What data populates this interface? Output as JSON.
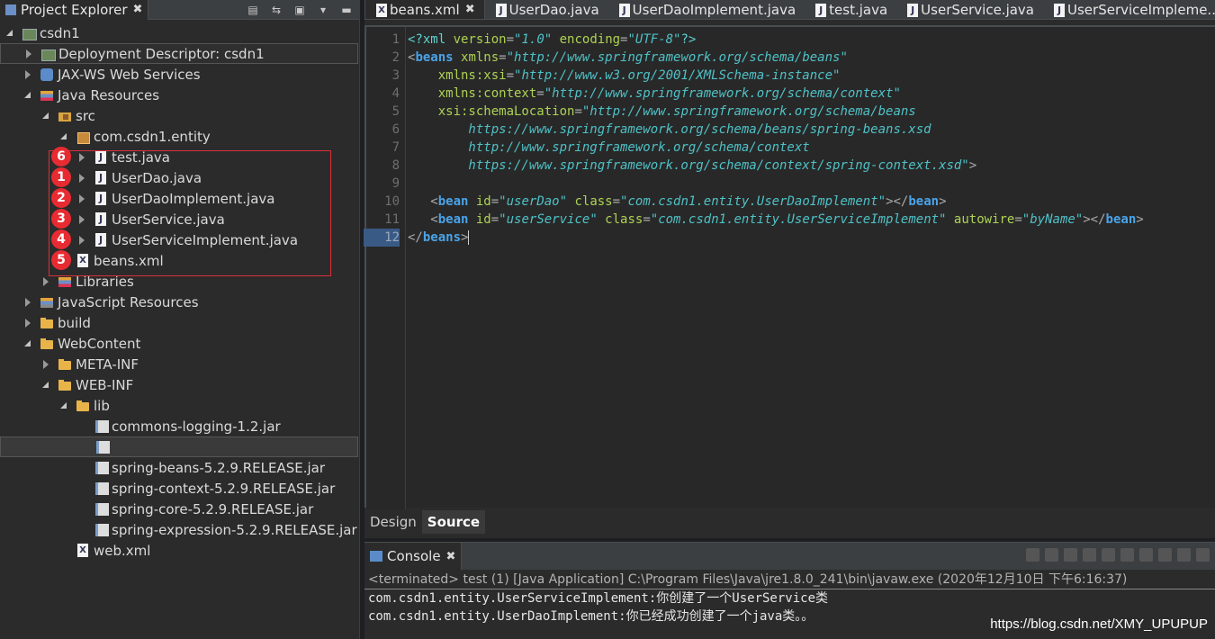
{
  "project_explorer": {
    "tab_label": "Project Explorer",
    "tree": [
      {
        "label": "csdn1",
        "icon": "project-icon",
        "state": "open",
        "level": 0
      },
      {
        "label": "Deployment Descriptor: csdn1",
        "icon": "deployment-descriptor-icon",
        "state": "closed",
        "level": 1,
        "selected": true
      },
      {
        "label": "JAX-WS Web Services",
        "icon": "web-services-icon",
        "state": "closed",
        "level": 1
      },
      {
        "label": "Java Resources",
        "icon": "java-resources-icon",
        "state": "open",
        "level": 1
      },
      {
        "label": "src",
        "icon": "source-folder-icon",
        "state": "open",
        "level": 2
      },
      {
        "label": "com.csdn1.entity",
        "icon": "package-icon",
        "state": "open",
        "level": 3
      },
      {
        "label": "test.java",
        "icon": "java-file-icon",
        "state": "closed",
        "level": 4,
        "badge": "6"
      },
      {
        "label": "UserDao.java",
        "icon": "java-interface-icon",
        "state": "closed",
        "level": 4,
        "badge": "1"
      },
      {
        "label": "UserDaoImplement.java",
        "icon": "java-file-icon",
        "state": "closed",
        "level": 4,
        "badge": "2"
      },
      {
        "label": "UserService.java",
        "icon": "java-interface-icon",
        "state": "closed",
        "level": 4,
        "badge": "3"
      },
      {
        "label": "UserServiceImplement.java",
        "icon": "java-file-icon",
        "state": "closed",
        "level": 4,
        "badge": "4"
      },
      {
        "label": "beans.xml",
        "icon": "xml-file-icon",
        "state": "none",
        "level": 3,
        "badge": "5"
      },
      {
        "label": "Libraries",
        "icon": "libraries-icon",
        "state": "closed",
        "level": 2
      },
      {
        "label": "JavaScript Resources",
        "icon": "javascript-resources-icon",
        "state": "closed",
        "level": 1
      },
      {
        "label": "build",
        "icon": "folder-icon",
        "state": "closed",
        "level": 1
      },
      {
        "label": "WebContent",
        "icon": "folder-icon",
        "state": "open",
        "level": 1
      },
      {
        "label": "META-INF",
        "icon": "folder-icon",
        "state": "closed",
        "level": 2
      },
      {
        "label": "WEB-INF",
        "icon": "folder-icon",
        "state": "open",
        "level": 2
      },
      {
        "label": "lib",
        "icon": "folder-icon",
        "state": "open",
        "level": 3
      },
      {
        "label": "commons-logging-1.2.jar",
        "icon": "jar-icon",
        "state": "none",
        "level": 4
      },
      {
        "label": "",
        "icon": "jar-icon",
        "state": "none",
        "level": 4,
        "highlighted": true
      },
      {
        "label": "spring-beans-5.2.9.RELEASE.jar",
        "icon": "jar-icon",
        "state": "none",
        "level": 4
      },
      {
        "label": "spring-context-5.2.9.RELEASE.jar",
        "icon": "jar-icon",
        "state": "none",
        "level": 4
      },
      {
        "label": "spring-core-5.2.9.RELEASE.jar",
        "icon": "jar-icon",
        "state": "none",
        "level": 4
      },
      {
        "label": "spring-expression-5.2.9.RELEASE.jar",
        "icon": "jar-icon",
        "state": "none",
        "level": 4
      },
      {
        "label": "web.xml",
        "icon": "xml-file-icon",
        "state": "none",
        "level": 3
      }
    ]
  },
  "editor": {
    "tabs": [
      {
        "label": "beans.xml",
        "icon": "xml-file-icon",
        "active": true
      },
      {
        "label": "UserDao.java",
        "icon": "java-file-icon"
      },
      {
        "label": "UserDaoImplement.java",
        "icon": "java-file-icon"
      },
      {
        "label": "test.java",
        "icon": "java-file-icon"
      },
      {
        "label": "UserService.java",
        "icon": "java-file-icon"
      },
      {
        "label": "UserServiceImpleme...",
        "icon": "java-file-icon"
      }
    ],
    "line_numbers": [
      "1",
      "2",
      "3",
      "4",
      "5",
      "6",
      "7",
      "8",
      "9",
      "10",
      "11",
      "12"
    ],
    "current_line": "12",
    "code_lines": [
      [
        [
          "pi",
          "<?xml "
        ],
        [
          "attr",
          "version"
        ],
        [
          "punc",
          "="
        ],
        [
          "val",
          "\"1.0\""
        ],
        [
          "attr",
          " encoding"
        ],
        [
          "punc",
          "="
        ],
        [
          "val",
          "\"UTF-8\""
        ],
        [
          "pi",
          "?>"
        ]
      ],
      [
        [
          "punc",
          "<"
        ],
        [
          "tag",
          "beans"
        ],
        [
          "attr",
          " xmlns"
        ],
        [
          "punc",
          "="
        ],
        [
          "val",
          "\"http://www.springframework.org/schema/beans\""
        ]
      ],
      [
        [
          "attr",
          "    xmlns:xsi"
        ],
        [
          "punc",
          "="
        ],
        [
          "val",
          "\"http://www.w3.org/2001/XMLSchema-instance\""
        ]
      ],
      [
        [
          "attr",
          "    xmlns:context"
        ],
        [
          "punc",
          "="
        ],
        [
          "val",
          "\"http://www.springframework.org/schema/context\""
        ]
      ],
      [
        [
          "attr",
          "    xsi:schemaLocation"
        ],
        [
          "punc",
          "="
        ],
        [
          "val",
          "\"http://www.springframework.org/schema/beans"
        ]
      ],
      [
        [
          "val",
          "        https://www.springframework.org/schema/beans/spring-beans.xsd"
        ]
      ],
      [
        [
          "val",
          "        http://www.springframework.org/schema/context"
        ]
      ],
      [
        [
          "val",
          "        https://www.springframework.org/schema/context/spring-context.xsd\""
        ],
        [
          "punc",
          ">"
        ]
      ],
      [],
      [
        [
          "punc",
          "   <"
        ],
        [
          "tag",
          "bean"
        ],
        [
          "attr",
          " id"
        ],
        [
          "punc",
          "="
        ],
        [
          "val",
          "\"userDao\""
        ],
        [
          "attr",
          " class"
        ],
        [
          "punc",
          "="
        ],
        [
          "val",
          "\"com.csdn1.entity.UserDaoImplement\""
        ],
        [
          "punc",
          "></"
        ],
        [
          "tag",
          "bean"
        ],
        [
          "punc",
          ">"
        ]
      ],
      [
        [
          "punc",
          "   <"
        ],
        [
          "tag",
          "bean"
        ],
        [
          "attr",
          " id"
        ],
        [
          "punc",
          "="
        ],
        [
          "val",
          "\"userService\""
        ],
        [
          "attr",
          " class"
        ],
        [
          "punc",
          "="
        ],
        [
          "val",
          "\"com.csdn1.entity.UserServiceImplement\""
        ],
        [
          "attr",
          " autowire"
        ],
        [
          "punc",
          "="
        ],
        [
          "val",
          "\"byName\""
        ],
        [
          "punc",
          "></"
        ],
        [
          "tag",
          "bean"
        ],
        [
          "punc",
          ">"
        ]
      ],
      [
        [
          "punc",
          "</"
        ],
        [
          "tag",
          "beans"
        ],
        [
          "punc",
          ">"
        ]
      ]
    ],
    "bottom_tabs": {
      "design": "Design",
      "source": "Source"
    }
  },
  "console": {
    "tab_label": "Console",
    "status": "<terminated> test (1) [Java Application] C:\\Program Files\\Java\\jre1.8.0_241\\bin\\javaw.exe (2020年12月10日 下午6:16:37)",
    "output": [
      "com.csdn1.entity.UserServiceImplement:你创建了一个UserService类",
      "com.csdn1.entity.UserDaoImplement:你已经成功创建了一个java类。。"
    ]
  },
  "watermark": "https://blog.csdn.net/XMY_UPUPUP",
  "colors": {
    "accent_red": "#e82b32",
    "tag": "#4aa3e8",
    "attr": "#aed254",
    "value": "#4fc1c6"
  }
}
